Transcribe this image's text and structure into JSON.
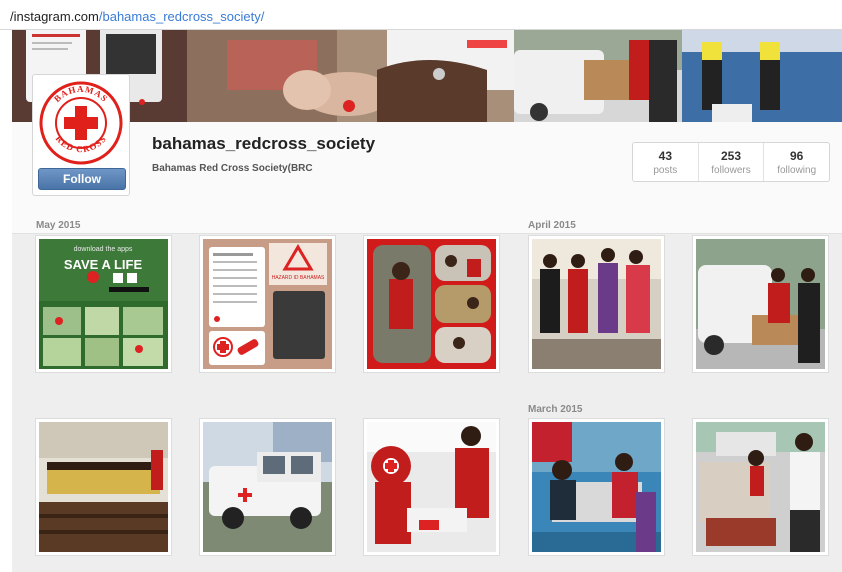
{
  "browser": {
    "url_host": "/instagram.com",
    "url_path": "/bahamas_redcross_society/"
  },
  "profile": {
    "username": "bahamas_redcross_society",
    "full_name": "Bahamas Red Cross Society(BRC",
    "follow_label": "Follow",
    "avatar_text_top": "BAHAMAS",
    "avatar_text_bottom": "RED CROSS",
    "stats": [
      {
        "value": "43",
        "label": "posts"
      },
      {
        "value": "253",
        "label": "followers"
      },
      {
        "value": "96",
        "label": "following"
      }
    ]
  },
  "cover_photos": [
    {
      "icon": "app-screens-photo"
    },
    {
      "icon": "cpr-training-photo"
    },
    {
      "icon": "van-delivery-photo"
    },
    {
      "icon": "fifa-volunteers-photo"
    }
  ],
  "months": [
    "May 2015",
    "April 2015",
    "March 2015"
  ],
  "posts_row1": [
    {
      "icon": "save-a-life-app-poster",
      "caption": "download the apps",
      "headline": "SAVE A LIFE"
    },
    {
      "icon": "app-screenshots-post",
      "caption": "HAZARD ID BAHAMAS"
    },
    {
      "icon": "collage-post"
    },
    {
      "icon": "group-photo-post"
    },
    {
      "icon": "van-delivery-post"
    }
  ],
  "posts_row2": [
    {
      "icon": "choir-photo-post"
    },
    {
      "icon": "red-cross-truck-post"
    },
    {
      "icon": "first-aid-training-post"
    },
    {
      "icon": "outdoor-event-post"
    },
    {
      "icon": "relief-distribution-post"
    }
  ],
  "colors": {
    "red_cross": "#e0201b",
    "follow_button": "#4a74a8",
    "background": "#eeeeee"
  }
}
